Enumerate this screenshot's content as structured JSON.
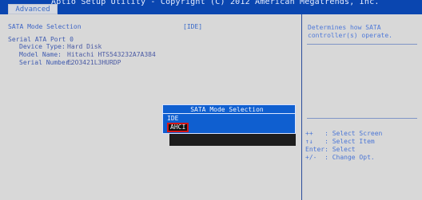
{
  "header": {
    "title": "Aptio Setup Utility - Copyright (C) 2012 American Megatrends, Inc.",
    "tab": "Advanced"
  },
  "main": {
    "sata_mode_label": "SATA Mode Selection",
    "sata_mode_value": "[IDE]",
    "port_label": "Serial ATA Port 0",
    "device_type_label": "Device Type:",
    "device_type_value": "Hard Disk",
    "model_name_label": "Model Name:",
    "model_name_value": "Hitachi HTS543232A7A384",
    "serial_number_label": "Serial Number:",
    "serial_number_value": "E2O3421L3HURDP"
  },
  "help": {
    "description": "Determines how SATA\ncontroller(s) operate.",
    "keys": "++   : Select Screen\n↑↓   : Select Item\nEnter: Select\n+/-  : Change Opt."
  },
  "popup": {
    "title": "SATA Mode Selection",
    "options": [
      "IDE",
      "AHCI"
    ]
  },
  "colors": {
    "background": "#1b2f73",
    "panel": "#d8d8d8",
    "popup": "#0f5fd0",
    "selection_outline": "#d61616",
    "text_accent": "#3e65c6"
  }
}
